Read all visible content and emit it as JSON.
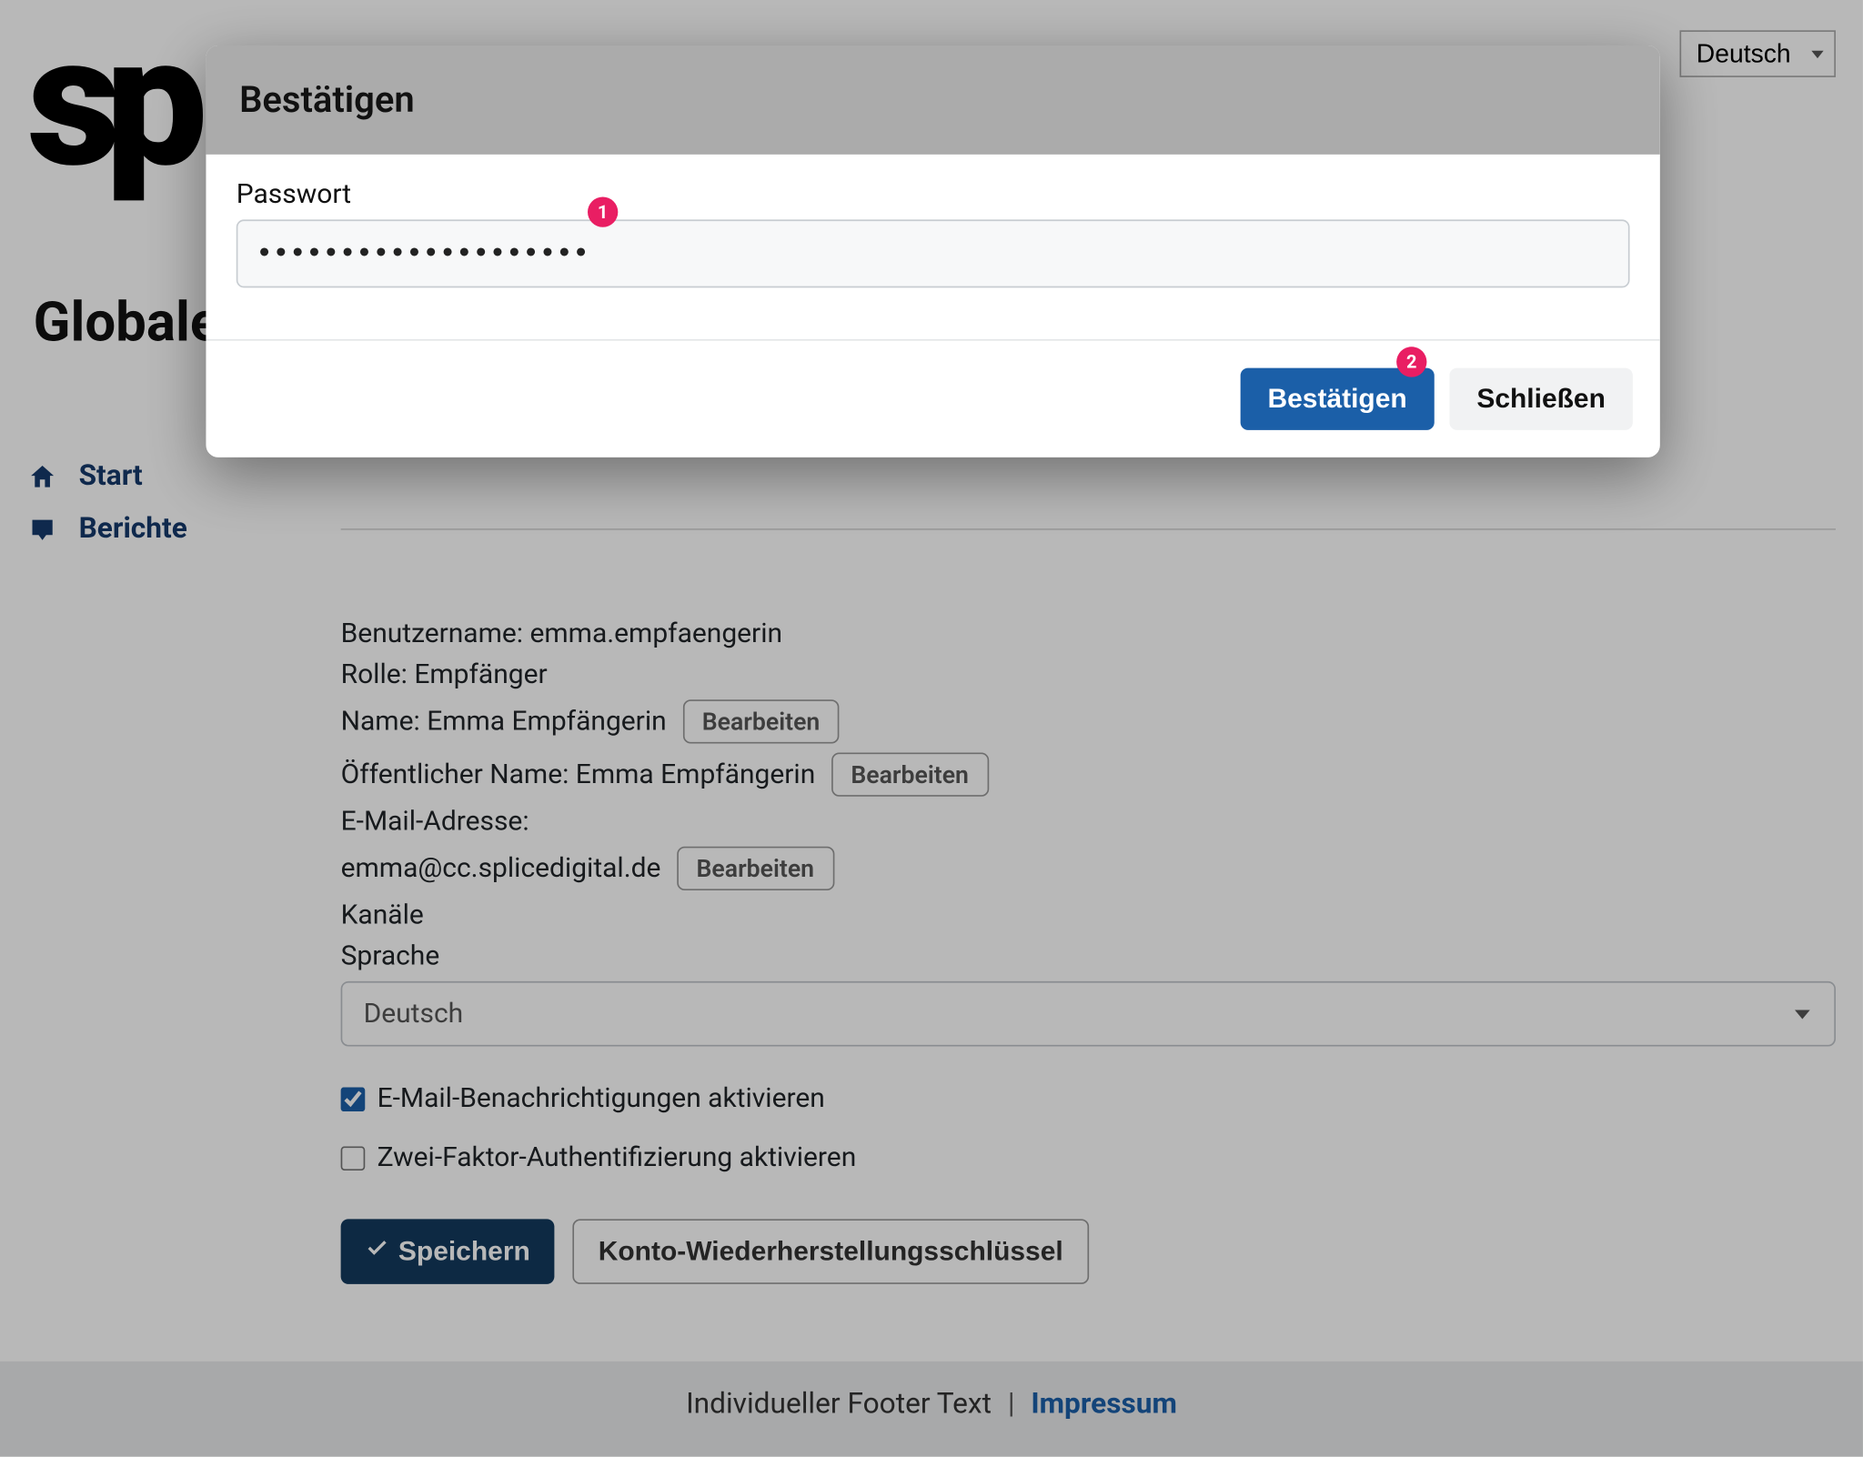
{
  "language_selector": {
    "value": "Deutsch"
  },
  "logo_text": "sp",
  "page_title": "Globale",
  "sidebar": {
    "items": [
      {
        "label": "Start"
      },
      {
        "label": "Berichte"
      }
    ]
  },
  "profile": {
    "username_label": "Benutzername:",
    "username_value": "emma.empfaengerin",
    "role_label": "Rolle:",
    "role_value": "Empfänger",
    "name_label": "Name:",
    "name_value": "Emma Empfängerin",
    "public_name_label": "Öffentlicher Name:",
    "public_name_value": "Emma Empfängerin",
    "email_label": "E-Mail-Adresse:",
    "email_value": "emma@cc.splicedigital.de",
    "channels_label": "Kanäle",
    "language_label": "Sprache",
    "language_value": "Deutsch",
    "edit_label": "Bearbeiten",
    "email_notif_label": "E-Mail-Benachrichtigungen aktivieren",
    "twofa_label": "Zwei-Faktor-Authentifizierung aktivieren",
    "save_label": "Speichern",
    "recovery_label": "Konto-Wiederherstellungsschlüssel"
  },
  "footer": {
    "text": "Individueller Footer Text",
    "impressum": "Impressum"
  },
  "modal": {
    "title": "Bestätigen",
    "password_label": "Passwort",
    "password_value": "••••••••••••••••••••",
    "confirm": "Bestätigen",
    "close": "Schließen"
  },
  "badges": {
    "b1": "1",
    "b2": "2"
  }
}
